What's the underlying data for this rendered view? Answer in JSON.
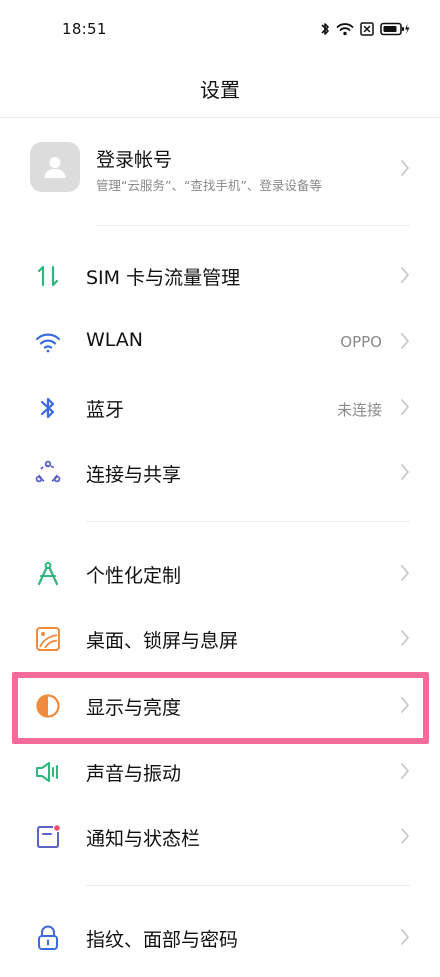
{
  "status": {
    "time": "18:51"
  },
  "header": {
    "title": "设置"
  },
  "account": {
    "name": "登录帐号",
    "subtitle": "管理“云服务”、“查找手机”、登录设备等",
    "avatar_icon": "person-icon"
  },
  "items": [
    {
      "label": "SIM 卡与流量管理",
      "value": "",
      "icon": "sim-data-icon",
      "color": "#2fb67c"
    },
    {
      "label": "WLAN",
      "value": "OPPO",
      "icon": "wifi-icon",
      "color": "#3d6be0"
    },
    {
      "label": "蓝牙",
      "value": "未连接",
      "icon": "bluetooth-icon",
      "color": "#3d6be0"
    },
    {
      "label": "连接与共享",
      "value": "",
      "icon": "connection-sharing-icon",
      "color": "#5b62c9"
    },
    {
      "label": "个性化定制",
      "value": "",
      "icon": "compass-icon",
      "color": "#2fb67c"
    },
    {
      "label": "桌面、锁屏与息屏",
      "value": "",
      "icon": "wallpaper-icon",
      "color": "#f08a3c"
    },
    {
      "label": "显示与亮度",
      "value": "",
      "icon": "brightness-icon",
      "color": "#f08a3c"
    },
    {
      "label": "声音与振动",
      "value": "",
      "icon": "speaker-icon",
      "color": "#2fb67c"
    },
    {
      "label": "通知与状态栏",
      "value": "",
      "icon": "notification-icon",
      "color": "#5b62c9"
    },
    {
      "label": "指纹、面部与密码",
      "value": "",
      "icon": "lock-icon",
      "color": "#3d6be0"
    }
  ],
  "highlight_color": "#f46a9b"
}
